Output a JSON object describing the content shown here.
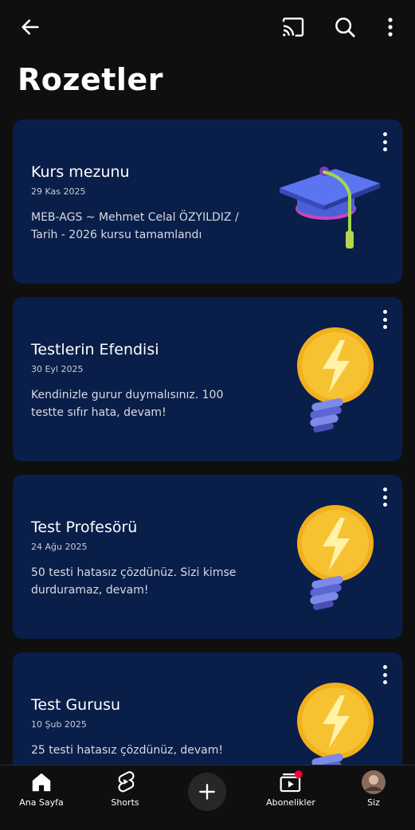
{
  "header": {
    "back_icon": "arrow-left-icon",
    "cast_icon": "cast-icon",
    "search_icon": "search-icon",
    "menu_icon": "more-vertical-icon"
  },
  "page": {
    "title": "Rozetler"
  },
  "badges": [
    {
      "title": "Kurs mezunu",
      "date": "29 Kas 2025",
      "description": "MEB-AGS ~ Mehmet Celal ÖZYILDIZ / Tarih - 2026 kursu tamamlandı",
      "art_icon": "graduation-cap-icon"
    },
    {
      "title": "Testlerin Efendisi",
      "date": "30 Eyl 2025",
      "description": "Kendinizle gurur duymalısınız. 100 testte sıfır hata, devam!",
      "art_icon": "lightbulb-bolt-icon"
    },
    {
      "title": "Test Profesörü",
      "date": "24 Ağu 2025",
      "description": "50 testi hatasız çözdünüz. Sizi kimse durduramaz, devam!",
      "art_icon": "lightbulb-bolt-icon"
    },
    {
      "title": "Test Gurusu",
      "date": "10 Şub 2025",
      "description": "25 testi hatasız çözdünüz, devam!",
      "art_icon": "lightbulb-bolt-icon"
    }
  ],
  "bottom_nav": {
    "home": "Ana Sayfa",
    "shorts": "Shorts",
    "subscriptions": "Abonelikler",
    "you": "Siz"
  },
  "colors": {
    "background": "#0f0f0f",
    "card": "#0a1e4a",
    "notification": "#ff0033"
  }
}
